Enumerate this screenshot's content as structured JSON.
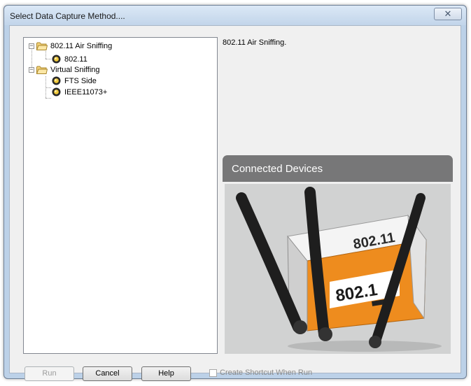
{
  "window": {
    "title": "Select Data Capture Method....",
    "close_glyph": "✕"
  },
  "tree": {
    "groups": [
      {
        "label": "802.11 Air Sniffing",
        "expander": "−",
        "children": [
          {
            "label": "802.11"
          }
        ]
      },
      {
        "label": "Virtual Sniffing",
        "expander": "−",
        "children": [
          {
            "label": "FTS Side"
          },
          {
            "label": "IEEE11073+"
          }
        ]
      }
    ]
  },
  "details": {
    "description": "802.11 Air Sniffing.",
    "panel_title": "Connected Devices",
    "device_label_top": "802.11",
    "device_label_front": "802.1"
  },
  "buttons": {
    "run": "Run",
    "cancel": "Cancel",
    "help": "Help"
  },
  "shortcut_checkbox": {
    "label": "Create Shortcut When Run",
    "checked": false
  },
  "colors": {
    "device_orange": "#ee8c1e",
    "panel_header": "#777778",
    "panel_body": "#d1d2d2"
  }
}
